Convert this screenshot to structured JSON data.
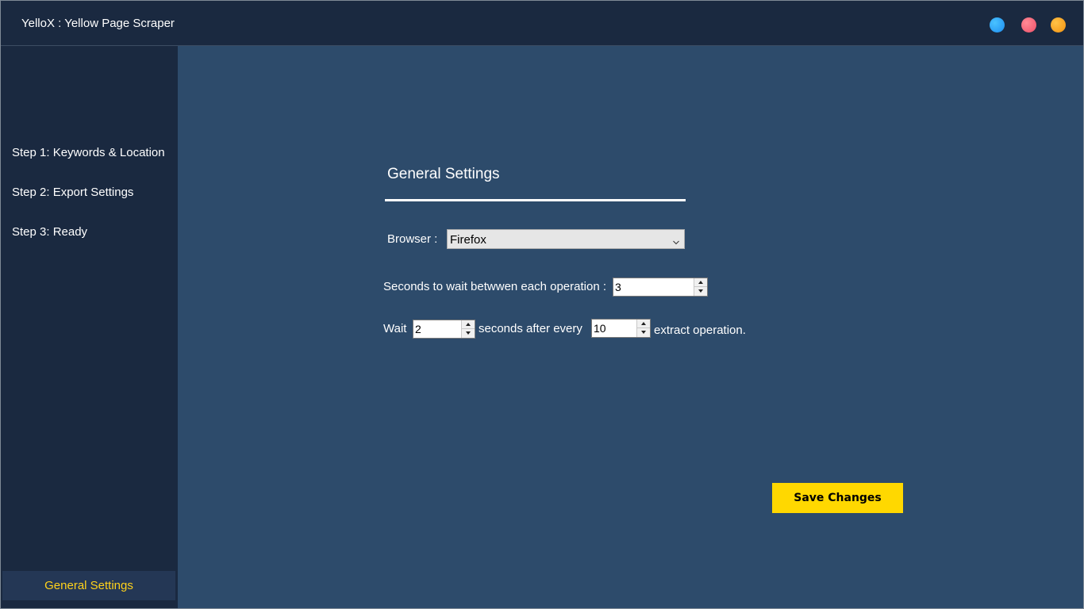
{
  "window": {
    "title": "YelloX : Yellow Page Scraper",
    "controls": [
      {
        "name": "blue-dot",
        "color": "#1e9cff"
      },
      {
        "name": "red-dot",
        "color": "#f25d70"
      },
      {
        "name": "orange-dot",
        "color": "#f5a21b"
      }
    ]
  },
  "sidebar": {
    "items": [
      {
        "label": "Step 1: Keywords & Location"
      },
      {
        "label": "Step 2: Export Settings"
      },
      {
        "label": "Step 3: Ready"
      }
    ],
    "active_item": {
      "label": "General Settings"
    }
  },
  "main": {
    "section_title": "General Settings",
    "browser": {
      "label": "Browser :",
      "selected": "Firefox"
    },
    "wait_between": {
      "label": "Seconds to wait betwwen each operation :",
      "value": "3"
    },
    "batch_wait": {
      "prefix": "Wait",
      "seconds": "2",
      "middle": "seconds after every",
      "count": "10",
      "suffix": "extract operation."
    },
    "save_label": "Save Changes"
  },
  "colors": {
    "accent": "#ffd800",
    "sidebar_bg": "#1a2940",
    "content_bg": "#2d4b6b",
    "active_text": "#ffd21a"
  }
}
